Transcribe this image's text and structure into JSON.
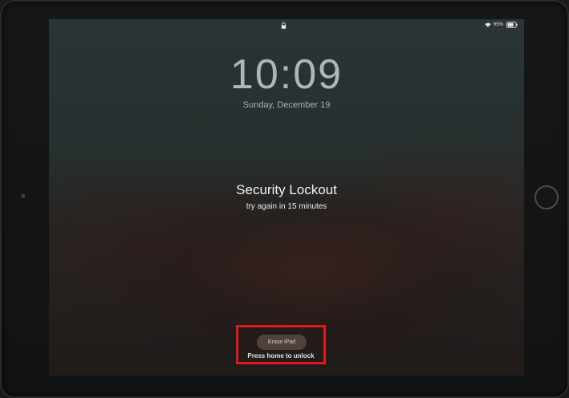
{
  "status_bar": {
    "lock_icon": "lock-icon",
    "wifi_icon": "wifi-icon",
    "battery_percent": "65%",
    "battery_icon": "battery-icon"
  },
  "lock_screen": {
    "time": "10:09",
    "date": "Sunday, December 19",
    "lockout_title": "Security Lockout",
    "lockout_message": "try again in 15 minutes",
    "erase_button_label": "Erase iPad",
    "home_hint": "Press home to unlock"
  },
  "colors": {
    "highlight_border": "#e0191f"
  }
}
